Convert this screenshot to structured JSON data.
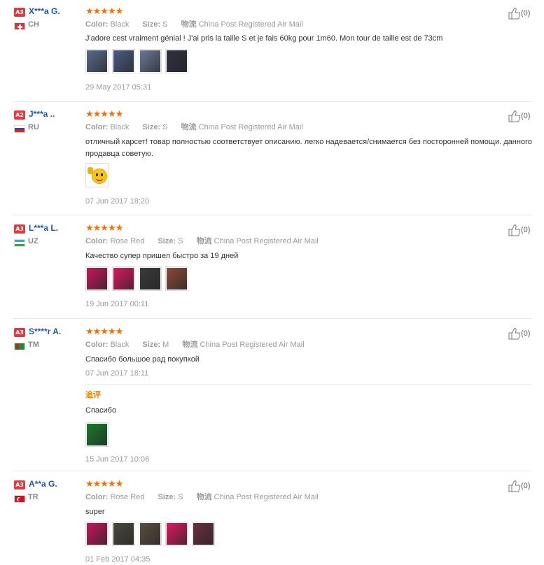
{
  "labels": {
    "color_key": "Color:",
    "size_key": "Size:",
    "ship_key": "物流",
    "followup_label": "追评"
  },
  "reviews": [
    {
      "badge": "A3",
      "user": "X***a G.",
      "country": "CH",
      "flag": "switzerland",
      "stars": "★★★★★",
      "color": "Black",
      "size": "S",
      "shipping": "China Post Registered Air Mail",
      "text": "J'adore cest vraiment génial ! J'ai pris la taille S et je fais 60kg pour 1m60. Mon tour de taille est de 73cm",
      "date": "29 May 2017 05:31",
      "likes": "(0)",
      "thumb_colors": [
        "#5a6b8a",
        "#4b5d82",
        "#6a7796",
        "#2e3140"
      ]
    },
    {
      "badge": "A2",
      "user": "J***a ..",
      "country": "RU",
      "flag": "russia",
      "stars": "★★★★★",
      "color": "Black",
      "size": "S",
      "shipping": "China Post Registered Air Mail",
      "text": "отличный карсет! товар полностью соответствует описанию. легко надевается/снимается без посторонней помощи. данного продавца советую.",
      "date": "07 Jun 2017 18:20",
      "likes": "(0)",
      "thumb_colors": [
        "#f5c518"
      ]
    },
    {
      "badge": "A3",
      "user": "L***a L.",
      "country": "UZ",
      "flag": "uzbekistan",
      "stars": "★★★★★",
      "color": "Rose Red",
      "size": "S",
      "shipping": "China Post Registered Air Mail",
      "text": "Качество супер пришел быстро за 19 дней",
      "date": "19 Jun 2017 00:11",
      "likes": "(0)",
      "thumb_colors": [
        "#c2185b",
        "#d81b60",
        "#3a3a3a",
        "#8a4a3a"
      ]
    },
    {
      "badge": "A3",
      "user": "S****r A.",
      "country": "TM",
      "flag": "turkmenistan",
      "stars": "★★★★★",
      "color": "Black",
      "size": "M",
      "shipping": "China Post Registered Air Mail",
      "text": "Спасибо большое рад покупкой",
      "date": "07 Jun 2017 18:11",
      "likes": "(0)",
      "followup_text": "Спасибо",
      "followup_date": "15 Jun 2017 10:08",
      "thumb_colors": [
        "#1b7a2e"
      ]
    },
    {
      "badge": "A3",
      "user": "A**a G.",
      "country": "TR",
      "flag": "turkey",
      "stars": "★★★★★",
      "color": "Rose Red",
      "size": "S",
      "shipping": "China Post Registered Air Mail",
      "text": "super",
      "date": "01 Feb 2017 04:35",
      "likes": "(0)",
      "thumb_colors": [
        "#c2185b",
        "#4a4a3a",
        "#5a5040",
        "#d81b60",
        "#6a3040"
      ]
    }
  ]
}
